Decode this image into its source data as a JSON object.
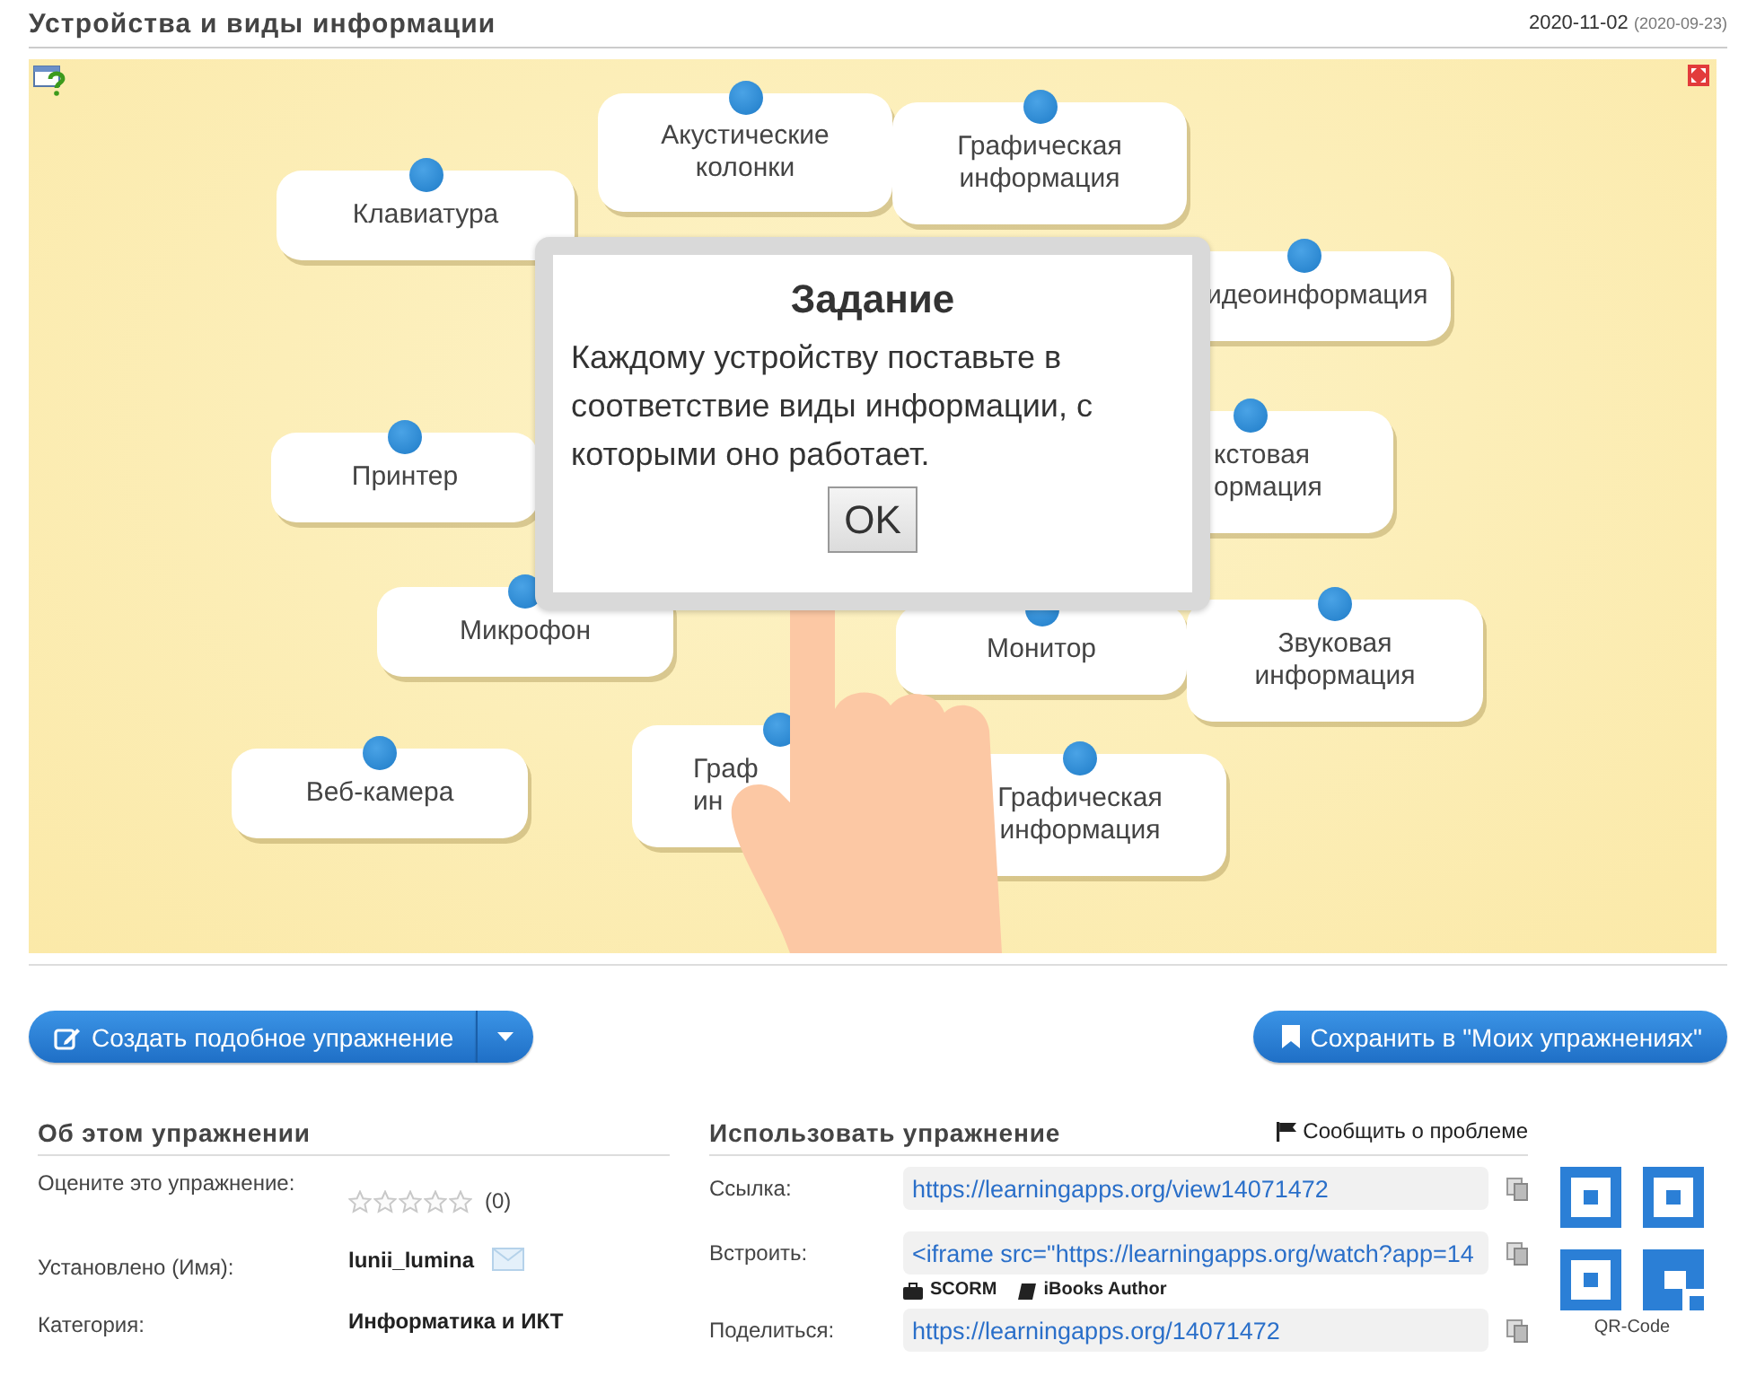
{
  "header": {
    "title": "Устройства и виды информации",
    "date": "2020-11-02",
    "date_created": "(2020-09-23)"
  },
  "exercise": {
    "cards": [
      {
        "text": "Клавиатура"
      },
      {
        "text": "Акустические колонки"
      },
      {
        "text": "Графическая информация"
      },
      {
        "text": "идеоинформация"
      },
      {
        "text": "Принтер"
      },
      {
        "text": "кстовая\nормация"
      },
      {
        "text": "Микрофон"
      },
      {
        "text": "Монитор"
      },
      {
        "text": "Звуковая информация"
      },
      {
        "text": "Веб-камера"
      },
      {
        "text": "Граф\nин"
      },
      {
        "text": "Графическая информация"
      }
    ],
    "dialog": {
      "title": "Задание",
      "text": "Каждому устройству поставьте в соответствие виды информации, с которыми оно работает.",
      "button": "OK"
    }
  },
  "actions": {
    "create_button": "Создать подобное упражнение",
    "save_button": "Сохранить в \"Моих упражнениях\""
  },
  "about": {
    "heading": "Об этом упражнении",
    "rating_label": "Оцените это упражнение:",
    "stars": 0,
    "rating_count": "(0)",
    "author_label": "Установлено (Имя):",
    "author": "lunii_lumina",
    "category_label": "Категория:",
    "category": "Информатика и ИКТ"
  },
  "use": {
    "heading": "Использовать упражнение",
    "report": "Сообщить о проблеме",
    "fields": [
      {
        "label": "Ссылка:",
        "value": "https://learningapps.org/view14071472"
      },
      {
        "label": "Встроить:",
        "value": "<iframe src=\"https://learningapps.org/watch?app=14",
        "exports": [
          "SCORM",
          "iBooks Author"
        ]
      },
      {
        "label": "Поделиться:",
        "value": "https://learningapps.org/14071472"
      }
    ],
    "qr_label": "QR-Code"
  }
}
